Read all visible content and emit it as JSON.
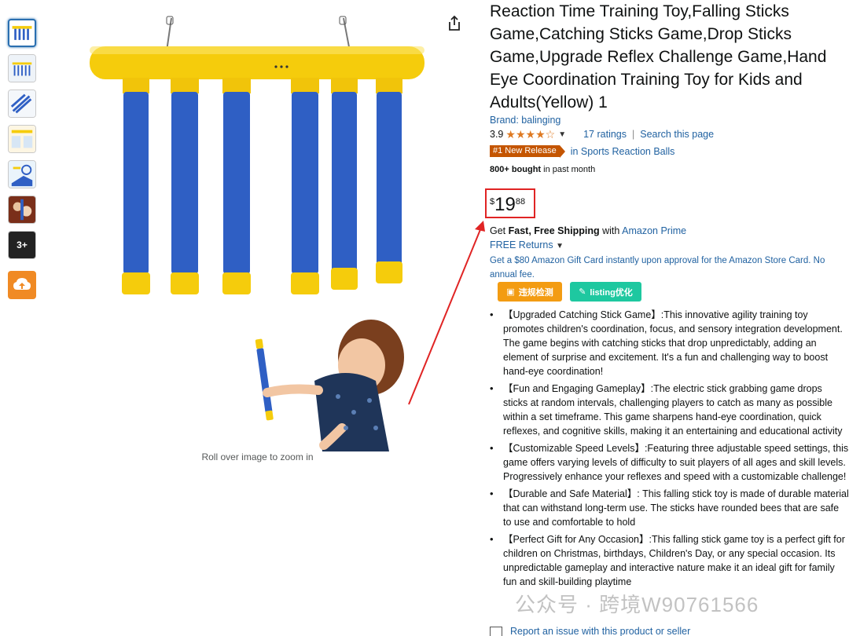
{
  "product": {
    "title": "Reaction Time Training Toy,Falling Sticks Game,Catching Sticks Game,Drop Sticks Game,Upgrade Reflex Challenge Game,Hand Eye Coordination Training Toy for Kids and Adults(Yellow) 1",
    "brand": "Brand: balinging",
    "rating": "3.9",
    "rating_stars": 3.9,
    "ratings_count": "17 ratings",
    "search_page": "Search this page",
    "badge": "#1 New Release",
    "badge_category": "in Sports Reaction Balls",
    "bought_bold": "800+ bought",
    "bought_rest": " in past month"
  },
  "price": {
    "symbol": "$",
    "whole": "19",
    "fraction": "88"
  },
  "shipping": {
    "prefix": "Get ",
    "bold": "Fast, Free Shipping",
    "middle": " with ",
    "prime": "Amazon Prime",
    "returns": "FREE Returns",
    "giftcard": "Get a $80 Amazon Gift Card instantly upon approval for the Amazon Store Card. No annual fee."
  },
  "tools": {
    "check_label": "违规检测",
    "listing_label": "listing优化"
  },
  "gallery": {
    "zoom_hint": "Roll over image to zoom in",
    "video_label": "3+"
  },
  "bullets": [
    "【Upgraded Catching Stick Game】:This innovative agility training toy promotes children's coordination, focus, and sensory integration development. The game begins with catching sticks that drop unpredictably, adding an element of surprise and excitement. It's a fun and challenging way to boost hand-eye coordination!",
    "【Fun and Engaging Gameplay】:The electric stick grabbing game drops sticks at random intervals, challenging players to catch as many as possible within a set timeframe. This game sharpens hand-eye coordination, quick reflexes, and cognitive skills, making it an entertaining and educational activity",
    "【Customizable Speed Levels】:Featuring three adjustable speed settings, this game offers varying levels of difficulty to suit players of all ages and skill levels. Progressively enhance your reflexes and speed with a customizable challenge!",
    "【Durable and Safe Material】: This falling stick toy is made of durable material that can withstand long-term use. The sticks have rounded bees that are safe to use and comfortable to hold",
    "【Perfect Gift for Any Occasion】:This falling stick game toy is a perfect gift for children on Christmas, birthdays, Children's Day, or any special occasion. Its unpredictable gameplay and interactive nature make it an ideal gift for family fun and skill-building playtime"
  ],
  "report": "Report an issue with this product or seller",
  "watermark": "公众号 · 跨境W90761566",
  "colors": {
    "link": "#2162a1",
    "star": "#de7921",
    "badge": "#c45500",
    "highlight": "#e02424",
    "toy_yellow": "#f5cc0c",
    "toy_blue": "#2f5fc4"
  }
}
